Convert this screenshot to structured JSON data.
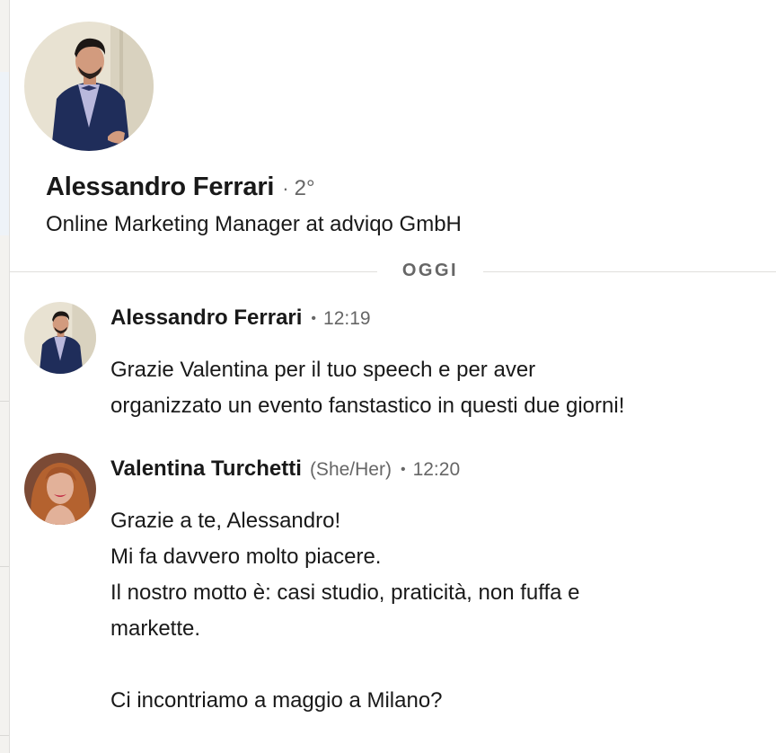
{
  "profile": {
    "name": "Alessandro Ferrari",
    "separator": "·",
    "degree": "2°",
    "headline": "Online Marketing Manager at adviqo GmbH"
  },
  "divider": {
    "label": "OGGI"
  },
  "messages": [
    {
      "sender": "Alessandro Ferrari",
      "pronouns": "",
      "separator": "•",
      "time": "12:19",
      "lines": [
        "Grazie Valentina per il tuo speech e per aver",
        "organizzato un evento fanstastico in questi due giorni!"
      ]
    },
    {
      "sender": "Valentina Turchetti",
      "pronouns": "(She/Her)",
      "separator": "•",
      "time": "12:20",
      "lines": [
        "Grazie a te, Alessandro!",
        "Mi fa davvero molto piacere.",
        "Il nostro motto è: casi studio, praticità, non fuffa e",
        "markette.",
        "",
        "Ci incontriamo a maggio a Milano?"
      ]
    }
  ],
  "colors": {
    "text_primary": "#191919",
    "text_secondary": "#666666",
    "divider": "#e0dfdc",
    "background": "#ffffff"
  }
}
